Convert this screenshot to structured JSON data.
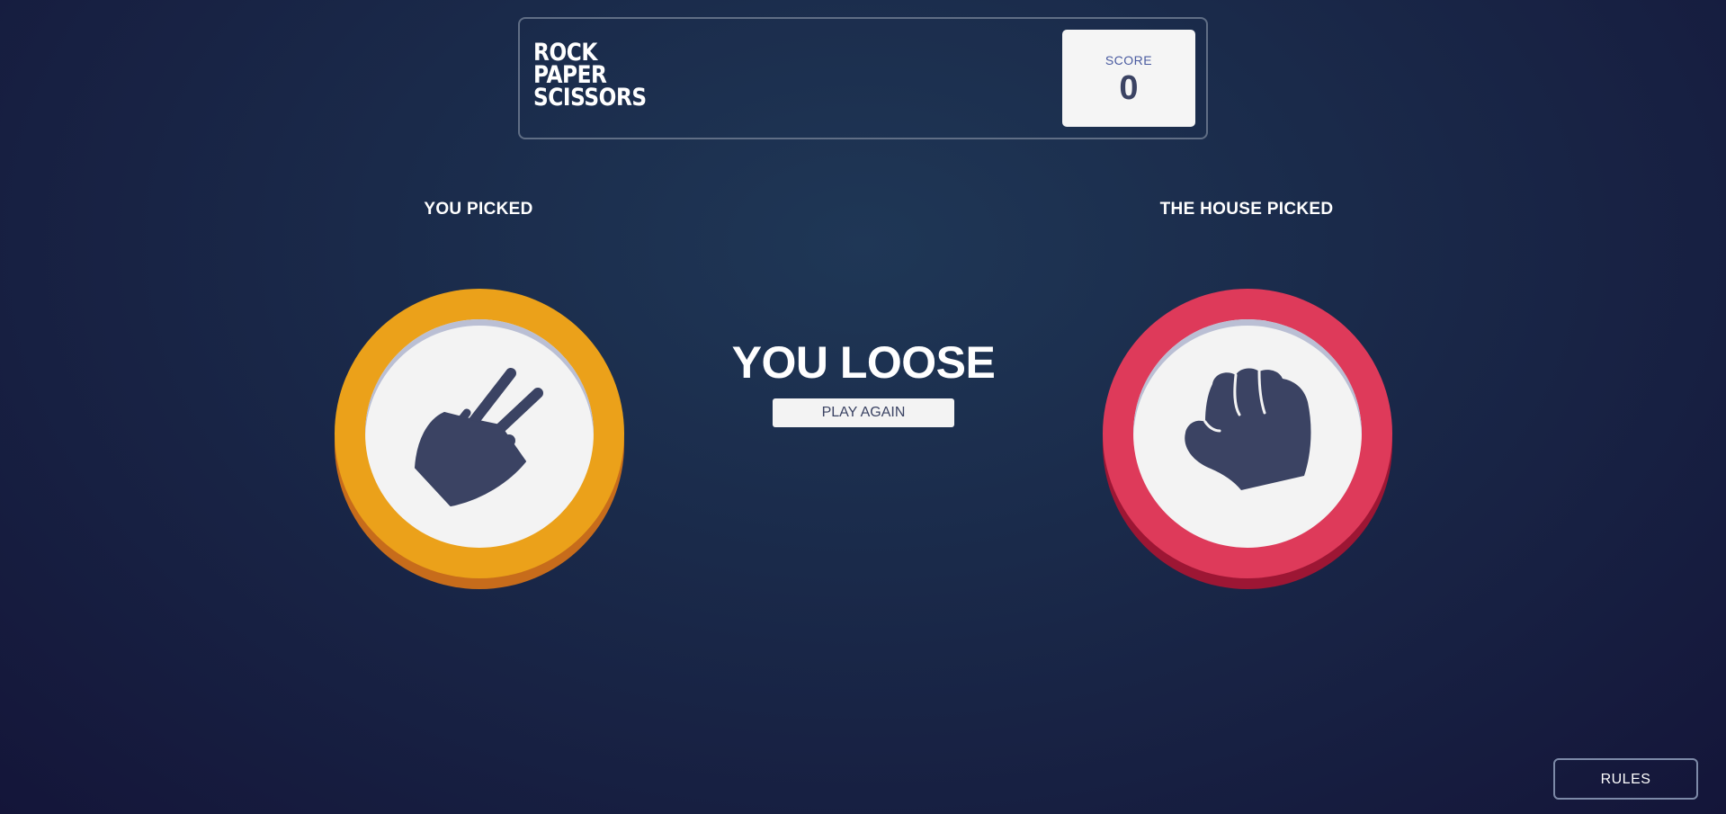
{
  "header": {
    "logo_lines": [
      "ROCK",
      "PAPER",
      "SCISSORS"
    ],
    "score_label": "SCORE",
    "score_value": "0"
  },
  "game": {
    "you_picked_label": "YOU PICKED",
    "house_picked_label": "THE HOUSE PICKED",
    "user_choice": "scissors",
    "house_choice": "rock",
    "result_text": "YOU LOOSE",
    "play_again_label": "PLAY AGAIN"
  },
  "footer": {
    "rules_label": "RULES"
  },
  "colors": {
    "background_center": "#1f3756",
    "background_edge": "#141539",
    "scissors_ring": "#eba11a",
    "scissors_shadow": "#c76c1b",
    "rock_ring": "#de3a5a",
    "rock_shadow": "#9d1634",
    "icon": "#3b4363",
    "score_label": "#4a5ba0"
  },
  "icons": {
    "user_token_icon": "scissors-hand-icon",
    "house_token_icon": "rock-fist-icon"
  }
}
